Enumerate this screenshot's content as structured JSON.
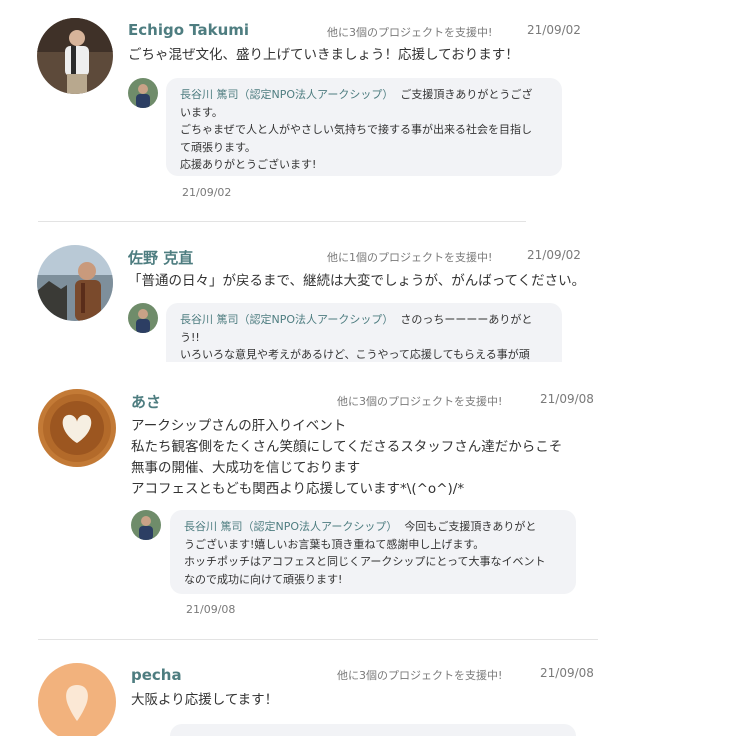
{
  "comments": [
    {
      "name": "Echigo Takumi",
      "support": "他に3個のプロジェクトを支援中!",
      "date": "21/09/02",
      "text": "ごちゃ混ぜ文化、盛り上げていきましょう！応援しております！",
      "reply": {
        "replier": "長谷川 篤司（認定NPO法人アークシップ）",
        "first": "ご支援頂きありがとうござ",
        "rest": "います。\nごちゃまぜで人と人がやさしい気持ちで接する事が出来る社会を目指し\nて頑張ります。\n応援ありがとうございます!",
        "date": "21/09/02"
      }
    },
    {
      "name": "佐野 克直",
      "support": "他に1個のプロジェクトを支援中!",
      "date": "21/09/02",
      "text": "「普通の日々」が戻るまで、継続は大変でしょうが、がんばってください。",
      "reply": {
        "replier": "長谷川 篤司（認定NPO法人アークシップ）",
        "first": "さのっちーーーーありがと",
        "rest": "う!!\nいろいろな意見や考えがあるけど、こうやって応援してもらえる事が頑"
      }
    },
    {
      "name": "あさ",
      "support": "他に3個のプロジェクトを支援中!",
      "date": "21/09/08",
      "text": "アークシップさんの肝入りイベント\n私たち観客側をたくさん笑顔にしてくださるスタッフさん達だからこそ\n無事の開催、大成功を信じております\nアコフェスともども関西より応援しています*\\(^o^)/*",
      "reply": {
        "replier": "長谷川 篤司（認定NPO法人アークシップ）",
        "first": "今回もご支援頂きありがと",
        "rest": "うございます!嬉しいお言葉も頂き重ねて感謝申し上げます。\nホッチポッチはアコフェスと同じくアークシップにとって大事なイベント\nなので成功に向けて頑張ります!",
        "date": "21/09/08"
      }
    },
    {
      "name": "pecha",
      "support": "他に3個のプロジェクトを支援中!",
      "date": "21/09/08",
      "text": "大阪より応援してます！"
    }
  ]
}
